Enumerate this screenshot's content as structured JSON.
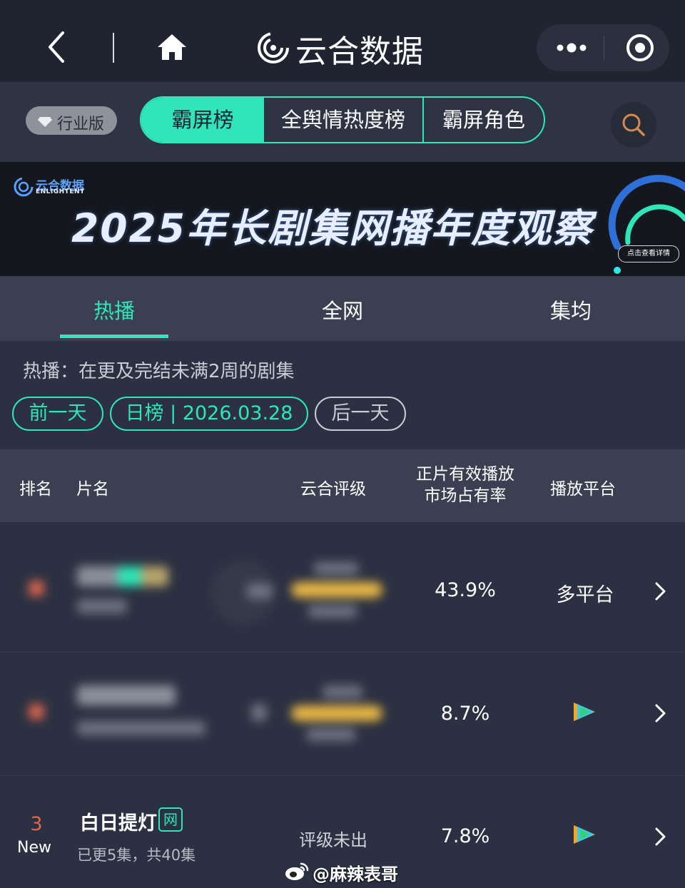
{
  "app": {
    "title": "云合数据"
  },
  "filters": {
    "industry_badge": "行业版",
    "segments": [
      "霸屏榜",
      "全舆情热度榜",
      "霸屏角色"
    ],
    "active_segment": "霸屏榜"
  },
  "banner": {
    "brand": "云合数据",
    "brand_en": "ENLIGHTENT",
    "title": "2025年长剧集网播年度观察",
    "detail_button": "点击查看详情"
  },
  "tabs": [
    "热播",
    "全网",
    "集均"
  ],
  "active_tab": "热播",
  "description": "热播：在更及完结未满2周的剧集",
  "date_nav": {
    "prev": "前一天",
    "current": "日榜 | 2026.03.28",
    "next": "后一天"
  },
  "table": {
    "headers": {
      "rank": "排名",
      "name": "片名",
      "rating": "云合评级",
      "share": "正片有效播放市场占有率",
      "platform": "播放平台"
    },
    "rows": [
      {
        "rank": "",
        "name": "",
        "share": "43.9%",
        "platform": "多平台",
        "platform_icon": ""
      },
      {
        "rank": "",
        "name": "",
        "share": "8.7%",
        "platform": "",
        "platform_icon": "tencent-video-icon"
      },
      {
        "rank": "3",
        "tag": "New",
        "name": "白日提灯",
        "badge": "网",
        "episodes": "已更5集，共40集",
        "rating": "评级未出",
        "share": "7.8%",
        "platform": "",
        "platform_icon": "tencent-video-icon"
      }
    ]
  },
  "watermark": "@麻辣表哥",
  "colors": {
    "accent": "#2ee6b8",
    "rank_red": "#e0674e",
    "background": "#2b3142",
    "header_bg": "#3a4052",
    "gold": "#e9b845"
  }
}
